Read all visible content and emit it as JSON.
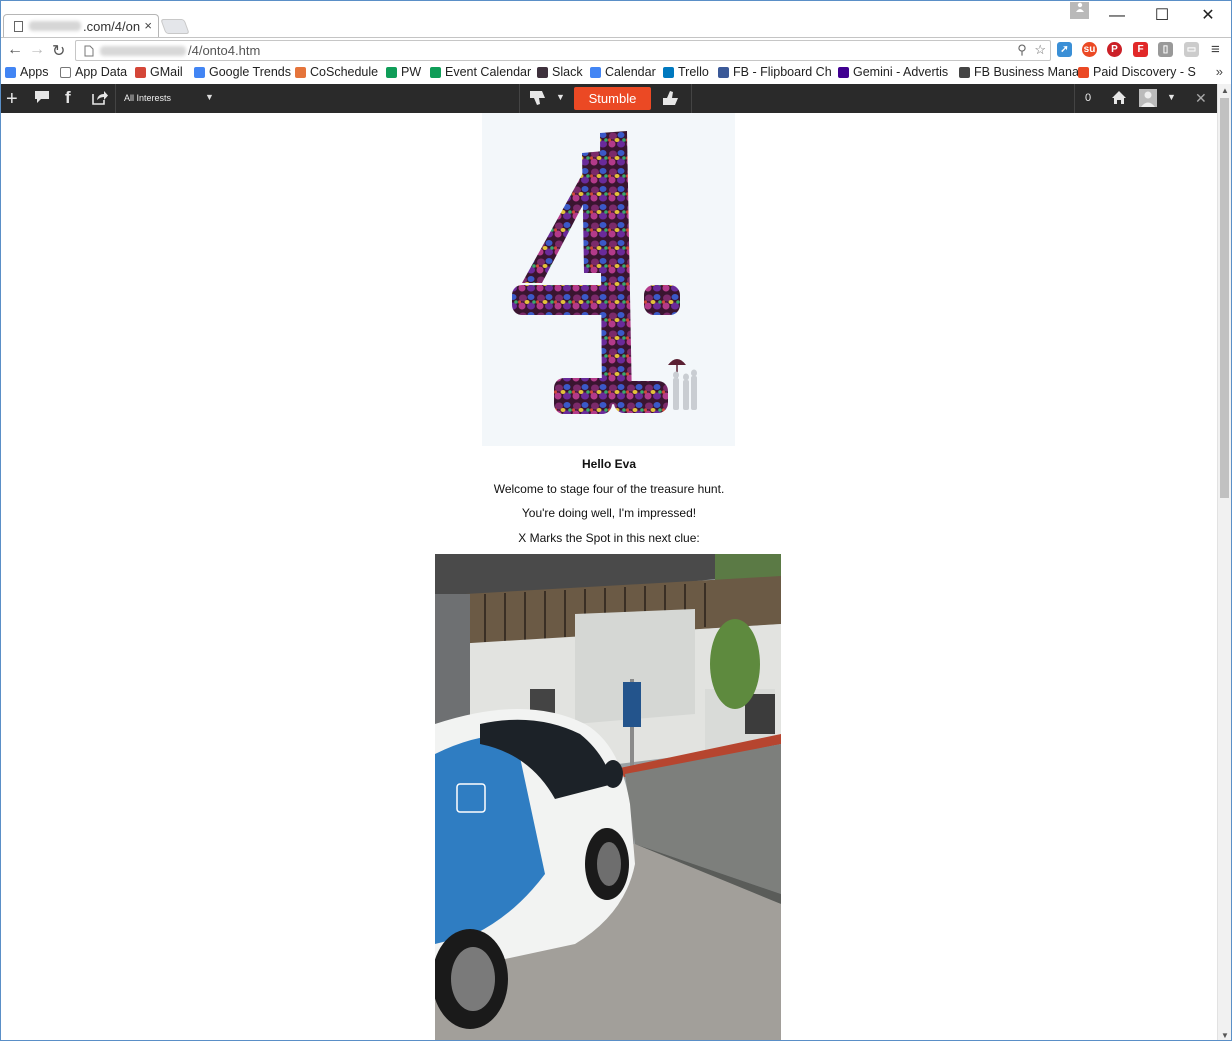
{
  "browser": {
    "tab_title": ".com/4/on",
    "tab_close": "×",
    "profile_icon": "person-icon",
    "minimize": "—",
    "maximize": "☐",
    "close": "✕",
    "url_suffix": "/4/onto4.htm"
  },
  "bookmarks": {
    "items": [
      {
        "label": "Apps",
        "icon": "apps-grid-icon",
        "color": "#4285f4"
      },
      {
        "label": "App Data",
        "icon": "page-icon",
        "color": "#ffffff"
      },
      {
        "label": "GMail",
        "icon": "gmail-icon",
        "color": "#d44638"
      },
      {
        "label": "Google Trends",
        "icon": "google-icon",
        "color": "#4285f4"
      },
      {
        "label": "CoSchedule",
        "icon": "coschedule-icon",
        "color": "#e5743b"
      },
      {
        "label": "PW",
        "icon": "sheets-icon",
        "color": "#0f9d58"
      },
      {
        "label": "Event Calendar",
        "icon": "sheets-icon",
        "color": "#0f9d58"
      },
      {
        "label": "Slack",
        "icon": "slack-icon",
        "color": "#3e313c"
      },
      {
        "label": "Calendar",
        "icon": "calendar-icon",
        "color": "#4285f4"
      },
      {
        "label": "Trello",
        "icon": "trello-icon",
        "color": "#0079bf"
      },
      {
        "label": "FB - Flipboard Ch",
        "icon": "facebook-icon",
        "color": "#3b5998"
      },
      {
        "label": "Gemini - Advertis",
        "icon": "yahoo-icon",
        "color": "#400090"
      },
      {
        "label": "FB Business Mana",
        "icon": "fb-business-icon",
        "color": "#444444"
      },
      {
        "label": "Paid Discovery - S",
        "icon": "stumbleupon-icon",
        "color": "#eb4924"
      }
    ],
    "more": "»"
  },
  "stumble": {
    "interests": "All Interests",
    "button": "Stumble",
    "count": "0",
    "close": "✕"
  },
  "page": {
    "greeting": "Hello Eva",
    "line1": "Welcome to stage four of the treasure hunt.",
    "line2": "You're doing well, I'm impressed!",
    "line3": "X Marks the Spot in this next clue:"
  },
  "colors": {
    "stumble_orange": "#eb4924",
    "stumble_bar": "#2a2a2a",
    "car_blue": "#2f7dc2"
  }
}
